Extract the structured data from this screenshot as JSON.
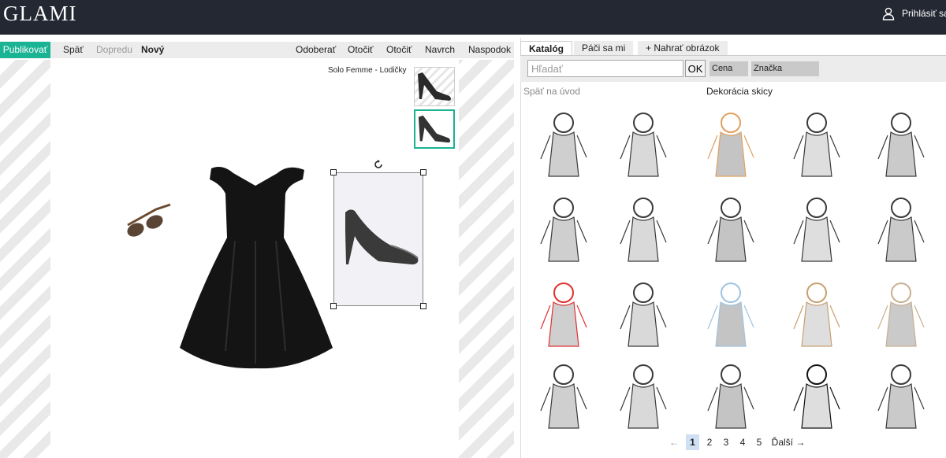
{
  "header": {
    "logo": "GLAMI",
    "login_label": "Prihlásiť sa"
  },
  "toolbar": {
    "publish": "Publikovať",
    "back": "Späť",
    "forward": "Dopredu",
    "new": "Nový",
    "remove": "Odoberať",
    "rotate_1": "Otočiť",
    "rotate_2": "Otočiť",
    "to_top": "Navrch",
    "to_bottom": "Naspodok"
  },
  "canvas": {
    "selected_item_title": "Solo Femme - Lodičky"
  },
  "panel": {
    "tabs": [
      "Katalóg",
      "Páči sa mi",
      "+ Nahrať obrázok"
    ],
    "search": {
      "placeholder": "Hľadať",
      "value": ""
    },
    "ok_label": "OK",
    "filters": [
      "Cena",
      "Značka"
    ],
    "back_link": "Späť na úvod",
    "section_title": "Dekorácia skicy",
    "thumbnails": [
      "fashion-girl-sketch",
      "woman-dress-sketch",
      "pinup-girl-sketch",
      "woman-portrait-sketch",
      "woman-flower-hair-sketch",
      "curly-woman-sketch",
      "man-sunglasses-sketch",
      "woman-bob-hair-sketch",
      "man-guitar-sketch",
      "mother-child-sketch",
      "woman-red-gown-sketch",
      "doves-rings-sketch",
      "glass-slipper-sketch",
      "city-castle-sketch",
      "london-skyline-sketch",
      "woman-leather-jacket-sketch",
      "blonde-woman-sketch",
      "woman-fur-coat-sketch",
      "lips-print-sketch",
      "woman-long-hair-sketch"
    ],
    "pagination": {
      "prev": "←",
      "pages": [
        "1",
        "2",
        "3",
        "4",
        "5"
      ],
      "current": "1",
      "next": "Ďalší →"
    }
  },
  "colors": {
    "header_bg": "#242833",
    "accent": "#1ab394"
  }
}
